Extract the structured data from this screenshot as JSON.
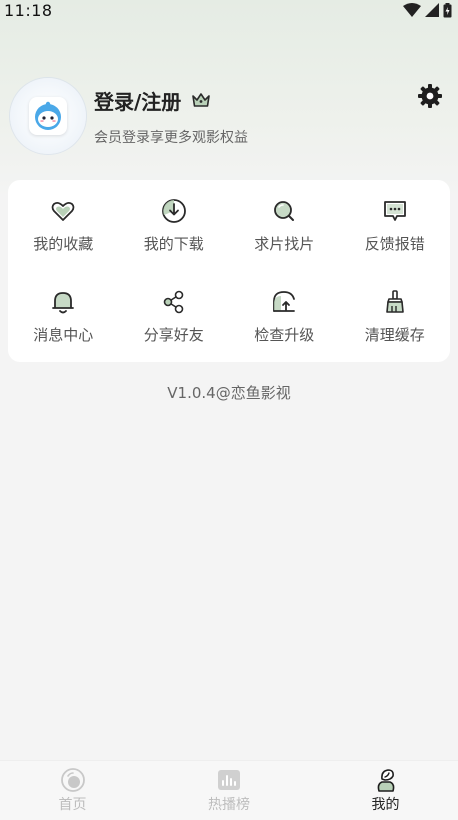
{
  "status_bar": {
    "time": "11:18"
  },
  "profile": {
    "title": "登录/注册",
    "subtitle": "会员登录享更多观影权益"
  },
  "grid": [
    {
      "label": "我的收藏",
      "icon": "heart-icon"
    },
    {
      "label": "我的下载",
      "icon": "download-icon"
    },
    {
      "label": "求片找片",
      "icon": "search-icon"
    },
    {
      "label": "反馈报错",
      "icon": "feedback-icon"
    },
    {
      "label": "消息中心",
      "icon": "bell-icon"
    },
    {
      "label": "分享好友",
      "icon": "share-icon"
    },
    {
      "label": "检查升级",
      "icon": "upgrade-icon"
    },
    {
      "label": "清理缓存",
      "icon": "broom-icon"
    }
  ],
  "version": "V1.0.4@恋鱼影视",
  "bottom_nav": [
    {
      "label": "首页",
      "icon": "home-icon",
      "active": false
    },
    {
      "label": "热播榜",
      "icon": "chart-icon",
      "active": false
    },
    {
      "label": "我的",
      "icon": "profile-icon",
      "active": true
    }
  ],
  "colors": {
    "accent_green": "#b9d1b8",
    "icon_stroke": "#2a2a2a"
  }
}
